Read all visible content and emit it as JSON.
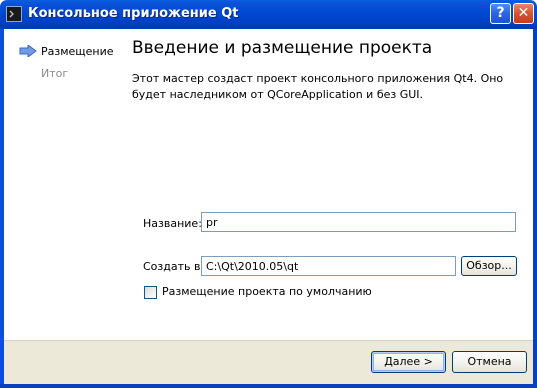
{
  "window": {
    "title": "Консольное приложение Qt",
    "help_glyph": "?",
    "close_glyph": "✕"
  },
  "sidebar": {
    "items": [
      {
        "label": "Размещение",
        "active": true
      },
      {
        "label": "Итог",
        "active": false
      }
    ]
  },
  "main": {
    "title": "Введение и размещение проекта",
    "description": "Этот мастер создаст проект консольного приложения Qt4. Оно будет наследником от QCoreApplication и без GUI."
  },
  "form": {
    "name_label": "Название:",
    "name_value": "pr",
    "path_label": "Создать в:",
    "path_value": "C:\\Qt\\2010.05\\qt",
    "browse_label": "Обзор...",
    "default_location_label": "Размещение проекта по умолчанию",
    "default_location_checked": false
  },
  "buttons": {
    "next_label": "Далее >",
    "cancel_label": "Отмена"
  },
  "colors": {
    "titlebar": "#0048d0",
    "dialog_background": "#ece9d8",
    "nav_arrow": "#4f7fd6",
    "inactive_text": "#8a8a8a"
  },
  "icons": {
    "app": "console-icon",
    "nav_arrow": "arrow-right-icon"
  }
}
